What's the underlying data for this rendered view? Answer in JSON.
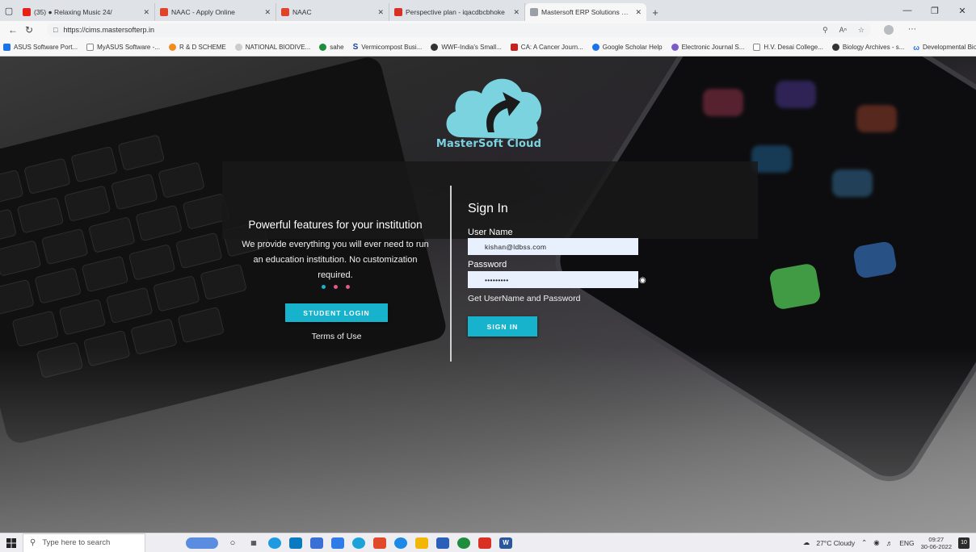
{
  "tabs": [
    {
      "label": "(35) ● Relaxing Music 24/",
      "fav_color": "#e62117"
    },
    {
      "label": "NAAC - Apply Online",
      "fav_color": "#e0442b"
    },
    {
      "label": "NAAC",
      "fav_color": "#e0442b"
    },
    {
      "label": "Perspective plan - iqacdbcbhoke",
      "fav_color": "#d93025"
    },
    {
      "label": "Mastersoft ERP Solutions Pvt.Ltd",
      "fav_color": "#9aa0a6"
    }
  ],
  "address": {
    "url": "https://cims.mastersofterp.in"
  },
  "bookmarks": [
    {
      "label": "ASUS Software Port...",
      "color": "#1a73e8"
    },
    {
      "label": "MyASUS Software -...",
      "color": "#888888"
    },
    {
      "label": "R & D SCHEME",
      "color": "#f28b20"
    },
    {
      "label": "NATIONAL BIODIVE...",
      "color": "#888888"
    },
    {
      "label": "sahe",
      "color": "#1e8e3e"
    },
    {
      "label": "Vermicompost Busi...",
      "color": "#1a3fa0"
    },
    {
      "label": "WWF-India's Small...",
      "color": "#333333"
    },
    {
      "label": "CA: A Cancer Journ...",
      "color": "#c5221f"
    },
    {
      "label": "Google Scholar Help",
      "color": "#1a73e8"
    },
    {
      "label": "Electronic Journal S...",
      "color": "#7b5cc7"
    },
    {
      "label": "H.V. Desai College...",
      "color": "#888888"
    },
    {
      "label": "Biology Archives - s...",
      "color": "#333333"
    },
    {
      "label": "Developmental Biol...",
      "color": "#1a73e8"
    }
  ],
  "logo": {
    "text": "MasterSoft Cloud"
  },
  "left_panel": {
    "title": "Powerful features for your institution",
    "description": "We provide everything you will ever need to run an education institution. No customization required.",
    "student_login": "STUDENT LOGIN",
    "terms": "Terms of Use"
  },
  "signin": {
    "title": "Sign In",
    "username_label": "User Name",
    "username_value": "kishan@ldbss.com",
    "password_label": "Password",
    "password_value": "•••••••••",
    "get_credentials": "Get UserName and Password",
    "button": "SIGN IN"
  },
  "taskbar": {
    "search_placeholder": "Type here to search",
    "weather": "27°C Cloudy",
    "lang": "ENG",
    "time": "09:27",
    "date": "30-06-2022",
    "notifications": "10"
  },
  "colors": {
    "accent": "#17b3cc",
    "logo": "#7cd3e0"
  }
}
